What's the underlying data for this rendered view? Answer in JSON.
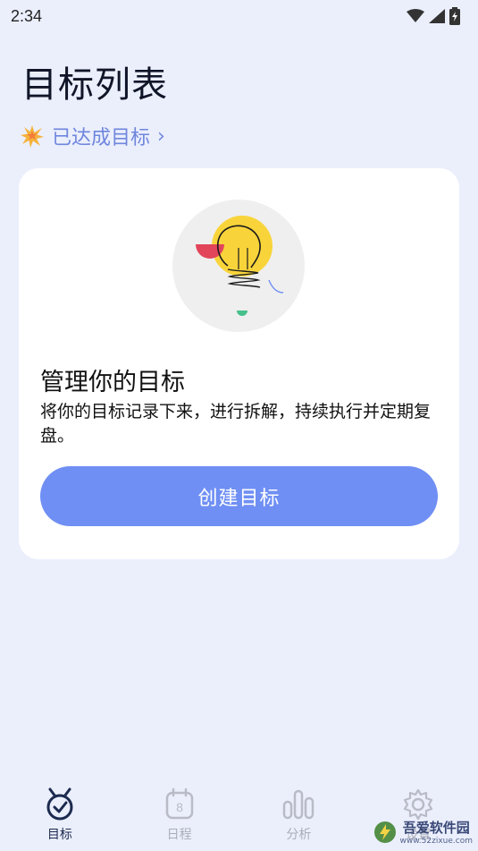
{
  "status": {
    "time": "2:34"
  },
  "header": {
    "title": "目标列表",
    "achieved_link": "已达成目标",
    "achieved_icon": "sparkle-icon"
  },
  "card": {
    "title": "管理你的目标",
    "description": "将你的目标记录下来，进行拆解，持续执行并定期复盘。",
    "button_label": "创建目标"
  },
  "nav": {
    "items": [
      {
        "label": "目标",
        "icon": "target-icon",
        "active": true
      },
      {
        "label": "日程",
        "icon": "calendar-icon",
        "badge": "8"
      },
      {
        "label": "分析",
        "icon": "chart-icon"
      },
      {
        "label": "设置",
        "icon": "gear-icon"
      }
    ]
  },
  "watermark": {
    "main": "吾爱软件园",
    "sub": "www.52zixue.com"
  },
  "colors": {
    "background": "#ebeffc",
    "accent": "#6f8ff4",
    "link": "#6f86dd"
  }
}
